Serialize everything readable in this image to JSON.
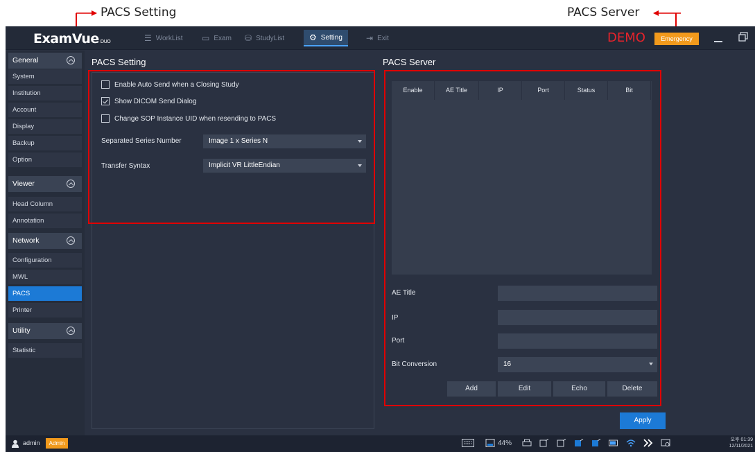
{
  "annotations": {
    "left_label": "PACS Setting",
    "right_label": "PACS Server"
  },
  "app": {
    "logo": "ExamVue",
    "logo_sub": "DUO",
    "demo_label": "DEMO",
    "emergency_label": "Emergency"
  },
  "nav": {
    "worklist": "WorkList",
    "exam": "Exam",
    "studylist": "StudyList",
    "setting": "Setting",
    "exit": "Exit"
  },
  "sidebar": {
    "general": {
      "title": "General",
      "items": [
        "System",
        "Institution",
        "Account",
        "Display",
        "Backup",
        "Option"
      ]
    },
    "viewer": {
      "title": "Viewer",
      "items": [
        "Head Column",
        "Annotation"
      ]
    },
    "network": {
      "title": "Network",
      "items": [
        "Configuration",
        "MWL",
        "PACS",
        "Printer"
      ]
    },
    "utility": {
      "title": "Utility",
      "items": [
        "Statistic"
      ]
    },
    "active_item": "PACS"
  },
  "pacs_setting": {
    "title": "PACS Setting",
    "options": [
      {
        "label": "Enable Auto Send when a Closing Study",
        "checked": false
      },
      {
        "label": "Show DICOM Send Dialog",
        "checked": true
      },
      {
        "label": "Change SOP Instance UID when resending to PACS",
        "checked": false
      }
    ],
    "separated_series_label": "Separated Series Number",
    "separated_series_value": "Image 1 x Series N",
    "transfer_syntax_label": "Transfer Syntax",
    "transfer_syntax_value": "Implicit VR LittleEndian"
  },
  "pacs_server": {
    "title": "PACS Server",
    "columns": [
      "Enable",
      "AE Title",
      "IP",
      "Port",
      "Status",
      "Bit"
    ],
    "ae_title_label": "AE Title",
    "ip_label": "IP",
    "port_label": "Port",
    "bit_conversion_label": "Bit Conversion",
    "bit_conversion_value": "16",
    "buttons": {
      "add": "Add",
      "edit": "Edit",
      "echo": "Echo",
      "delete": "Delete"
    }
  },
  "apply_label": "Apply",
  "taskbar": {
    "user": "admin",
    "role": "Admin",
    "battery": "44%",
    "time": "오후 01:39",
    "date": "12/11/2021"
  },
  "colors": {
    "accent": "#1c7ad6",
    "emergency": "#f29a1c",
    "demo": "#e8232b",
    "annotation": "#e00000"
  }
}
